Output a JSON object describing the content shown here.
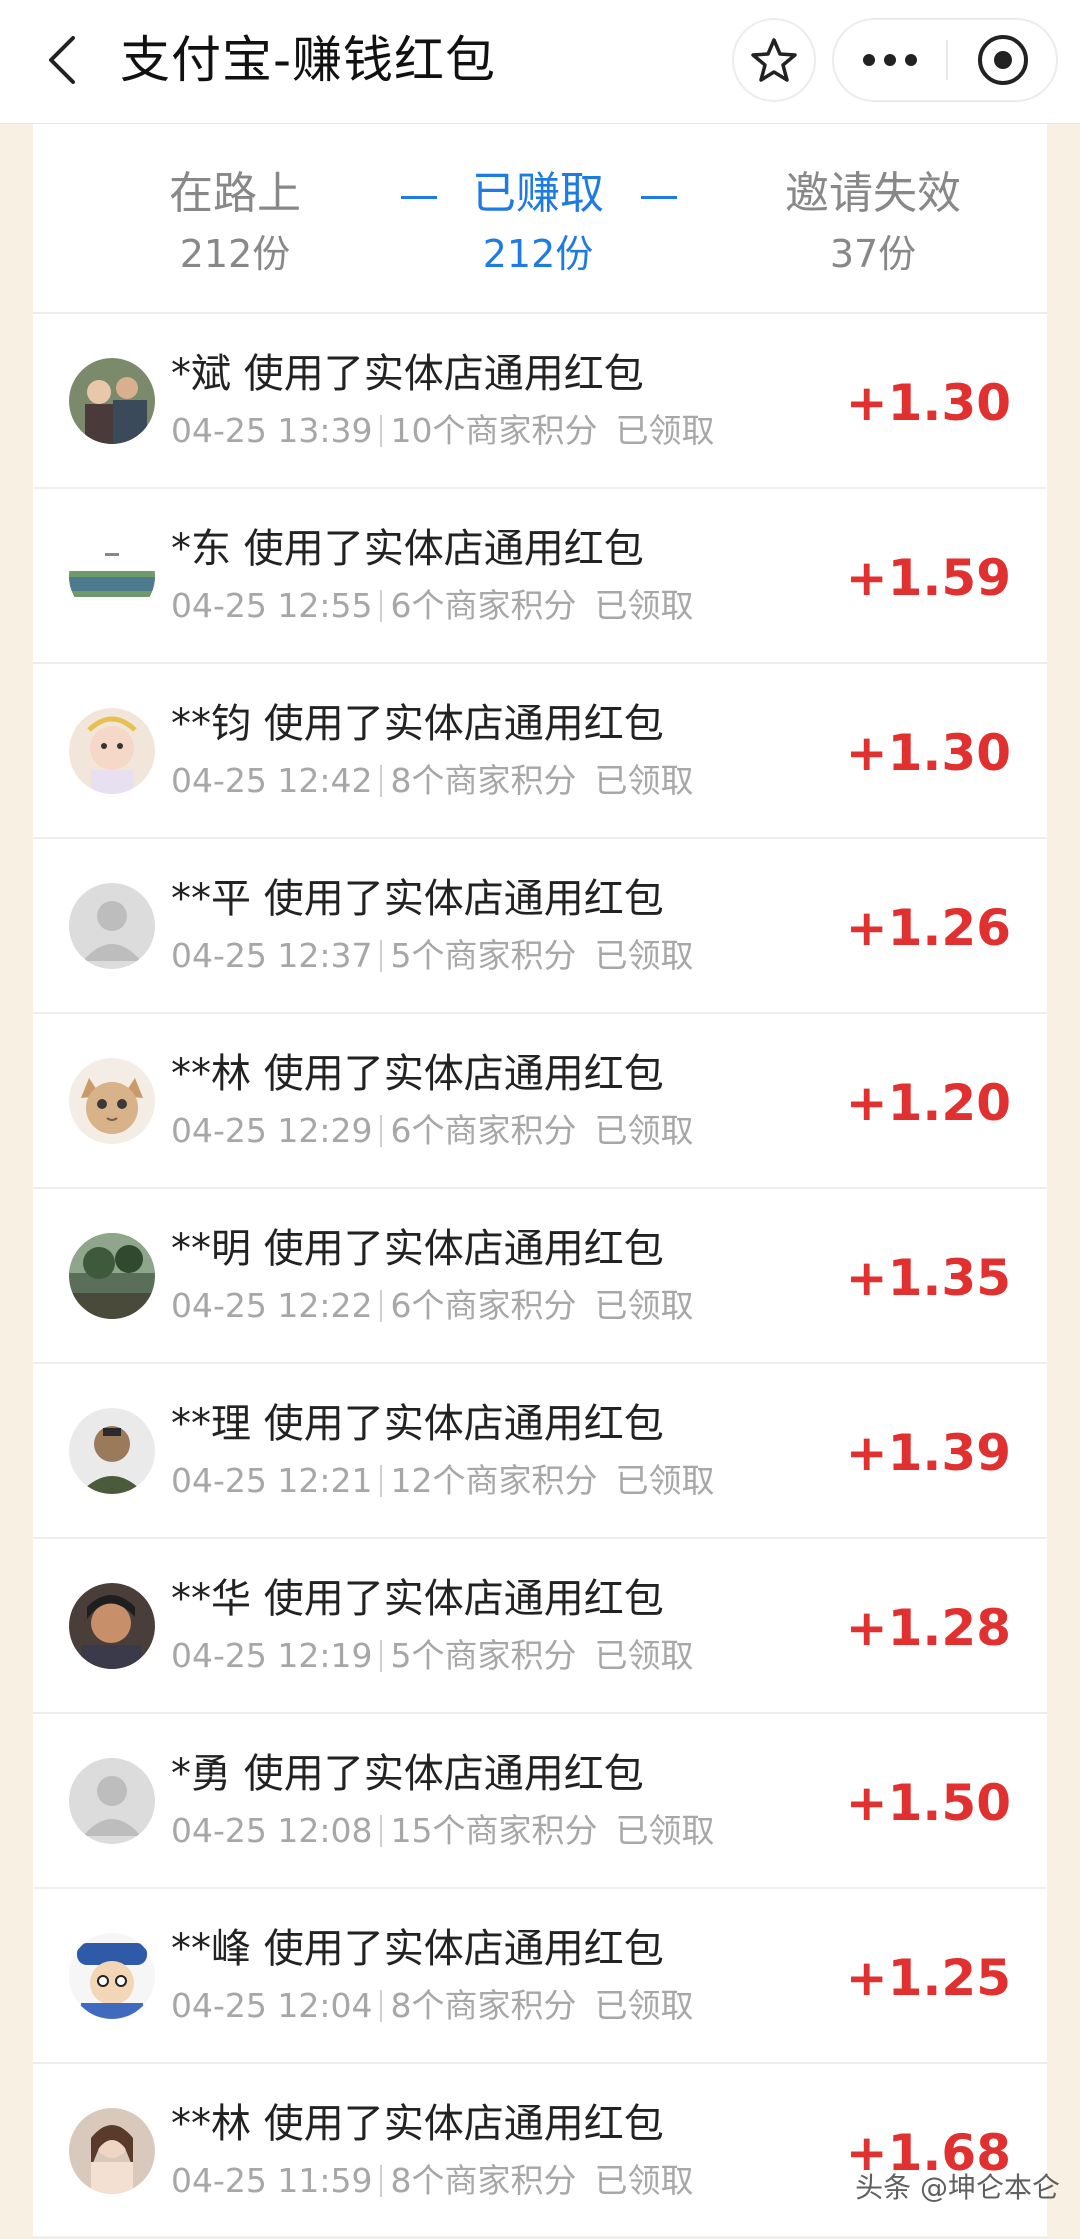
{
  "header": {
    "title": "支付宝-赚钱红包"
  },
  "tabs": [
    {
      "label": "在路上",
      "count": "212份"
    },
    {
      "label": "已赚取",
      "count": "212份"
    },
    {
      "label": "邀请失效",
      "count": "37份"
    }
  ],
  "colors": {
    "accent": "#1e7be4",
    "amount": "#e0302f",
    "meta": "#a7a7a7"
  },
  "rows": [
    {
      "name": "*斌 使用了实体店通用红包",
      "time": "04-25 13:39",
      "points": "10个商家积分",
      "status": "已领取",
      "amount": "+1.30"
    },
    {
      "name": "*东 使用了实体店通用红包",
      "time": "04-25 12:55",
      "points": "6个商家积分",
      "status": "已领取",
      "amount": "+1.59"
    },
    {
      "name": "**钧 使用了实体店通用红包",
      "time": "04-25 12:42",
      "points": "8个商家积分",
      "status": "已领取",
      "amount": "+1.30"
    },
    {
      "name": "**平 使用了实体店通用红包",
      "time": "04-25 12:37",
      "points": "5个商家积分",
      "status": "已领取",
      "amount": "+1.26"
    },
    {
      "name": "**林 使用了实体店通用红包",
      "time": "04-25 12:29",
      "points": "6个商家积分",
      "status": "已领取",
      "amount": "+1.20"
    },
    {
      "name": "**明 使用了实体店通用红包",
      "time": "04-25 12:22",
      "points": "6个商家积分",
      "status": "已领取",
      "amount": "+1.35"
    },
    {
      "name": "**理 使用了实体店通用红包",
      "time": "04-25 12:21",
      "points": "12个商家积分",
      "status": "已领取",
      "amount": "+1.39"
    },
    {
      "name": "**华 使用了实体店通用红包",
      "time": "04-25 12:19",
      "points": "5个商家积分",
      "status": "已领取",
      "amount": "+1.28"
    },
    {
      "name": "*勇 使用了实体店通用红包",
      "time": "04-25 12:08",
      "points": "15个商家积分",
      "status": "已领取",
      "amount": "+1.50"
    },
    {
      "name": "**峰 使用了实体店通用红包",
      "time": "04-25 12:04",
      "points": "8个商家积分",
      "status": "已领取",
      "amount": "+1.25"
    },
    {
      "name": "**林 使用了实体店通用红包",
      "time": "04-25 11:59",
      "points": "8个商家积分",
      "status": "已领取",
      "amount": "+1.68"
    }
  ],
  "watermark": "头条 @坤仑本仑"
}
